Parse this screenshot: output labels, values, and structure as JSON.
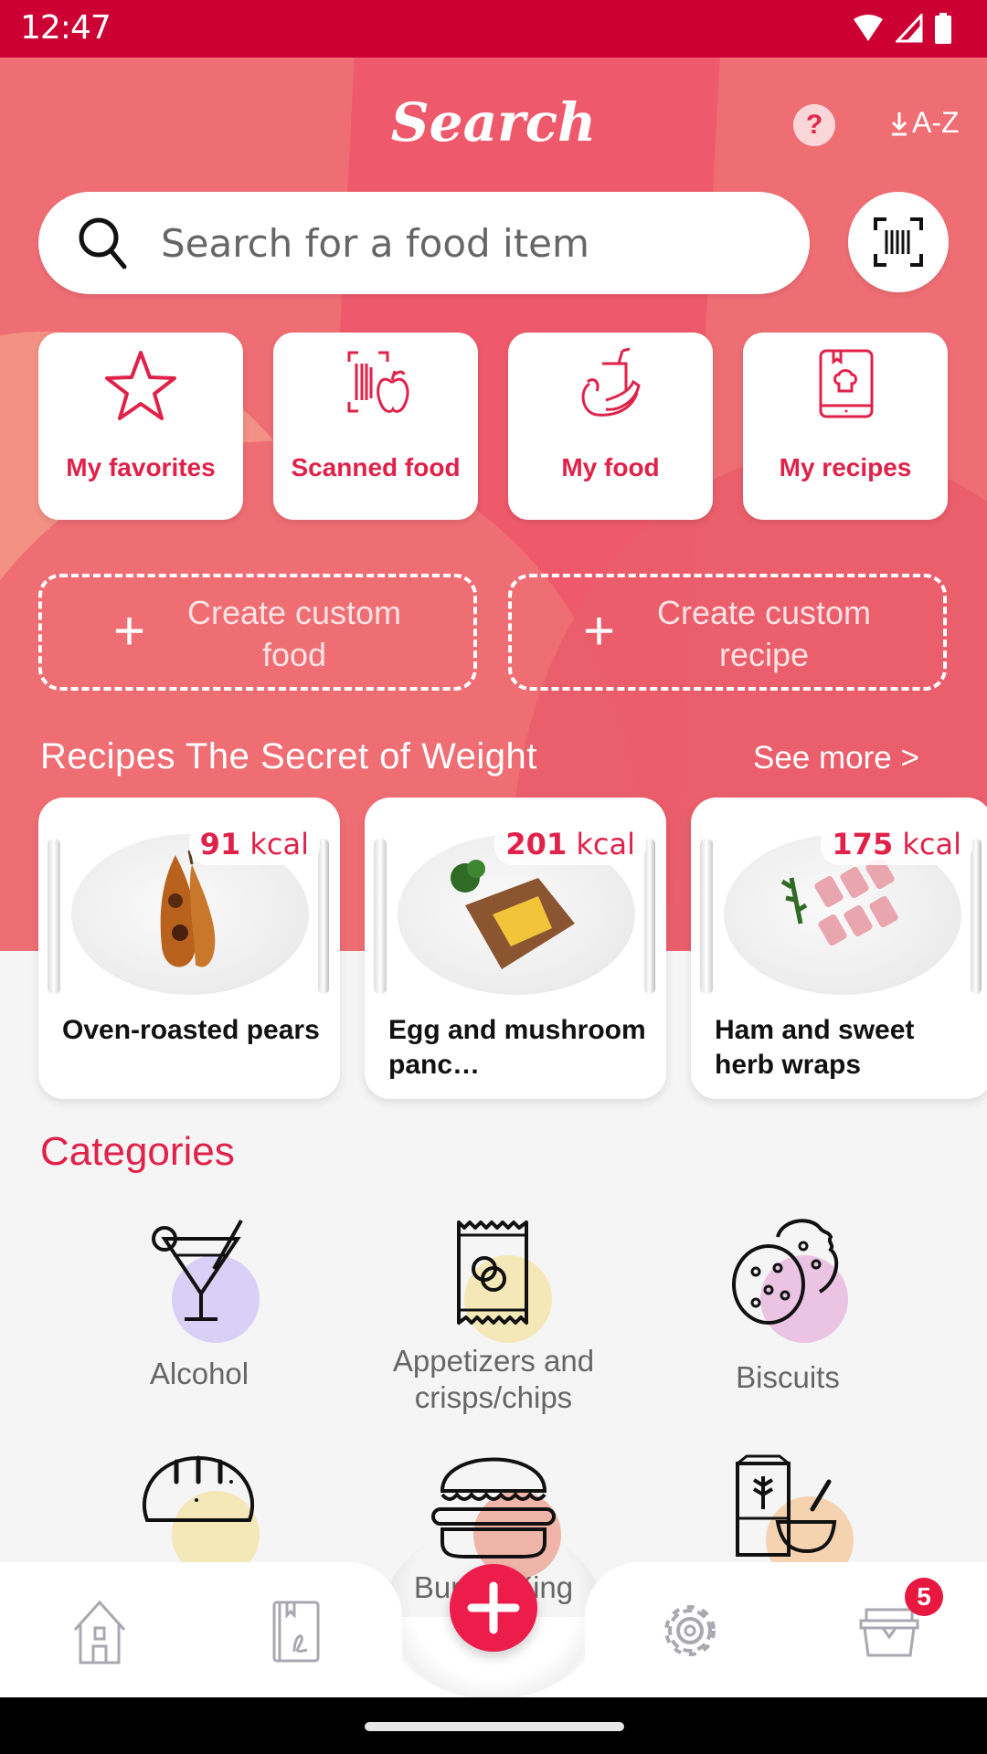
{
  "status_bar": {
    "time": "12:47"
  },
  "header": {
    "title": "Search",
    "help_icon": "question-icon",
    "sort_label": "A-Z"
  },
  "search": {
    "placeholder": "Search for a food item",
    "value": ""
  },
  "quick_access": [
    {
      "label": "My favorites",
      "icon": "star-icon"
    },
    {
      "label": "Scanned food",
      "icon": "barcode-apple-icon"
    },
    {
      "label": "My food",
      "icon": "food-bowl-icon"
    },
    {
      "label": "My recipes",
      "icon": "recipe-book-icon"
    }
  ],
  "create_buttons": [
    {
      "label": "Create custom food"
    },
    {
      "label": "Create custom recipe"
    }
  ],
  "recipes_section": {
    "title": "Recipes The Secret of Weight",
    "see_more": "See more >",
    "items": [
      {
        "kcal_value": "91",
        "kcal_unit": "kcal",
        "name": "Oven-roasted pears"
      },
      {
        "kcal_value": "201",
        "kcal_unit": "kcal",
        "name": "Egg and mushroom panc…"
      },
      {
        "kcal_value": "175",
        "kcal_unit": "kcal",
        "name": "Ham and sweet herb wraps"
      }
    ]
  },
  "categories": {
    "title": "Categories",
    "items": [
      {
        "label": "Alcohol",
        "icon": "cocktail-icon",
        "color": "#d9d0f7"
      },
      {
        "label": "Appetizers and crisps/chips",
        "icon": "chips-bag-icon",
        "color": "#f5e8b8"
      },
      {
        "label": "Biscuits",
        "icon": "cookies-icon",
        "color": "#ebc4e4"
      },
      {
        "label": "",
        "icon": "bread-icon",
        "color": "#f5e8b8"
      },
      {
        "label": "Burger King",
        "icon": "burger-icon",
        "color": "#efb5a8"
      },
      {
        "label": "",
        "icon": "cereal-icon",
        "color": "#f5d2b0"
      }
    ]
  },
  "bottom_nav": {
    "items": [
      {
        "name": "home",
        "icon": "house-icon"
      },
      {
        "name": "journal",
        "icon": "journal-icon"
      },
      {
        "name": "add",
        "icon": "plus-icon"
      },
      {
        "name": "settings",
        "icon": "gear-icon"
      },
      {
        "name": "basket",
        "icon": "basket-icon"
      }
    ],
    "basket_badge": "5"
  },
  "colors": {
    "accent": "#e0224a",
    "status_bar": "#cc0033",
    "hero": "#ee6e74",
    "fab": "#ec1d4b"
  }
}
